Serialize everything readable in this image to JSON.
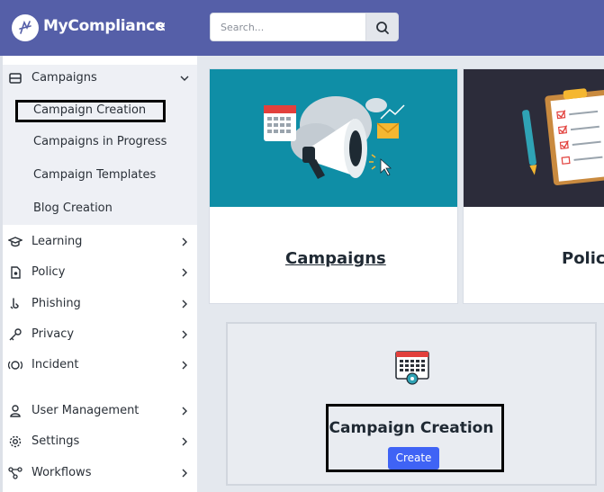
{
  "app": {
    "name": "MyCompliance",
    "brand_color": "#555fa8",
    "accent_color": "#3f63f5",
    "collapse_glyph": "«"
  },
  "search": {
    "placeholder": "Search..."
  },
  "sidebar": {
    "campaigns": {
      "label": "Campaigns",
      "icon": "campaigns-icon",
      "sub_items": [
        {
          "label": "Campaign Creation",
          "selected": true
        },
        {
          "label": "Campaigns in Progress"
        },
        {
          "label": "Campaign Templates"
        },
        {
          "label": "Blog Creation"
        }
      ]
    },
    "items": [
      {
        "label": "Learning",
        "icon": "graduation-cap-icon"
      },
      {
        "label": "Policy",
        "icon": "policy-icon"
      },
      {
        "label": "Phishing",
        "icon": "hook-icon"
      },
      {
        "label": "Privacy",
        "icon": "key-icon"
      },
      {
        "label": "Incident",
        "icon": "incident-icon"
      },
      {
        "label": "User Management",
        "icon": "user-management-icon"
      },
      {
        "label": "Settings",
        "icon": "gear-icon"
      },
      {
        "label": "Workflows",
        "icon": "workflow-icon"
      }
    ]
  },
  "cards": [
    {
      "title": "Campaigns",
      "image": "megaphone-illustration"
    },
    {
      "title": "Policy",
      "image": "clipboard-checklist-illustration"
    }
  ],
  "create_panel": {
    "title": "Campaign Creation",
    "button": "Create",
    "icon": "calendar-gear-icon"
  }
}
